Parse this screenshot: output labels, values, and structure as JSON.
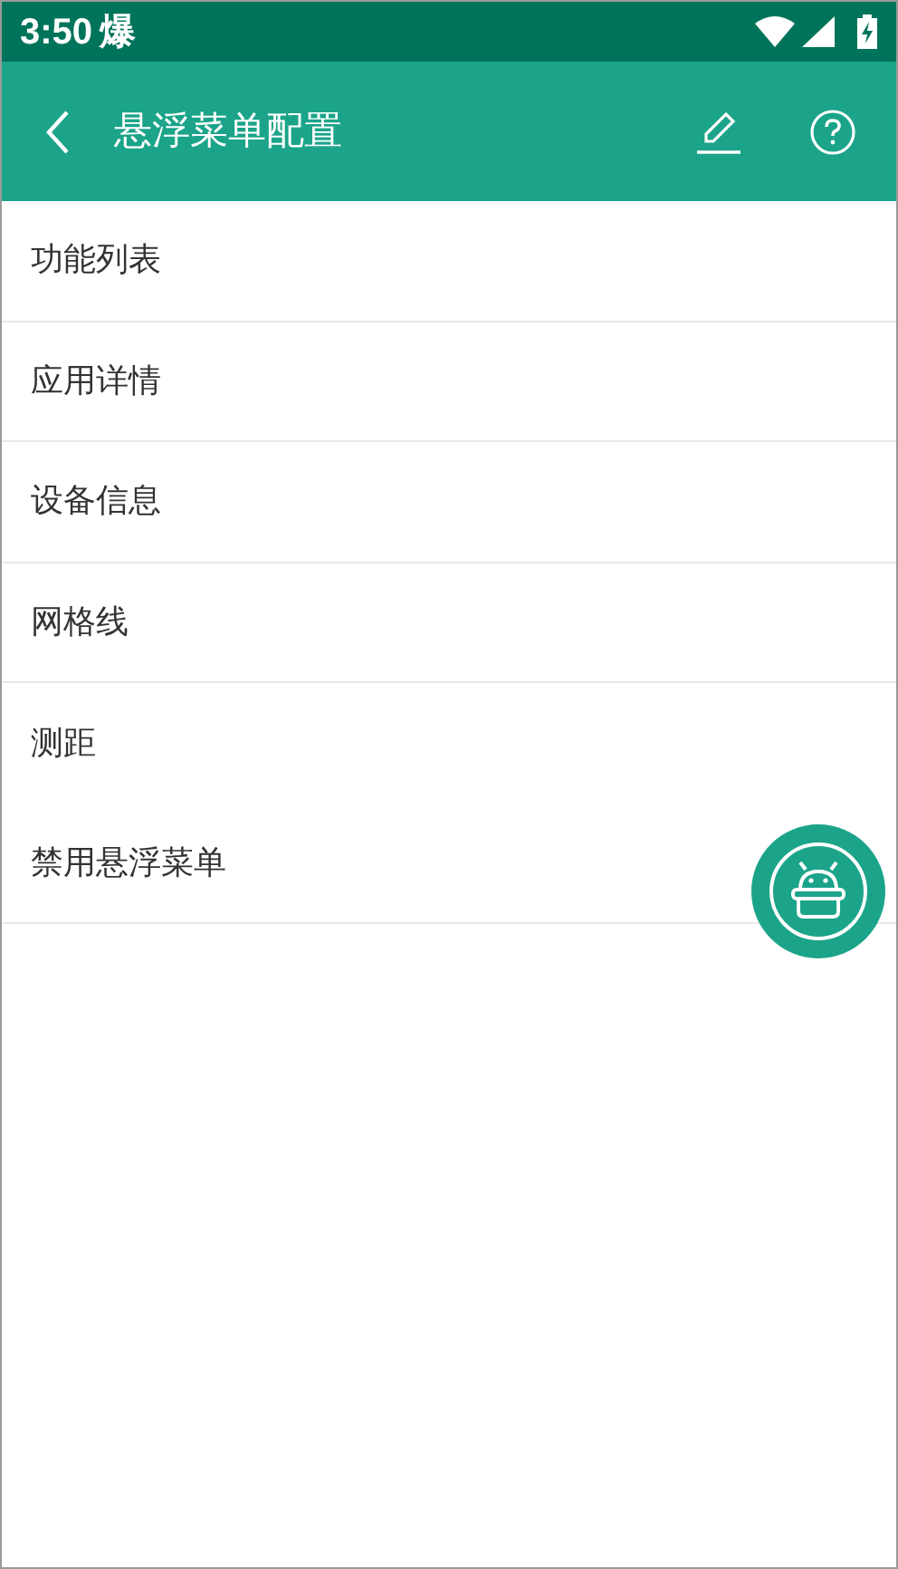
{
  "status_bar": {
    "time": "3:50",
    "notification": "爆"
  },
  "app_bar": {
    "title": "悬浮菜单配置"
  },
  "items": [
    {
      "label": "功能列表",
      "divider": true
    },
    {
      "label": "应用详情",
      "divider": true
    },
    {
      "label": "设备信息",
      "divider": true
    },
    {
      "label": "网格线",
      "divider": true
    },
    {
      "label": "测距",
      "divider": false
    },
    {
      "label": "禁用悬浮菜单",
      "divider": true
    }
  ]
}
